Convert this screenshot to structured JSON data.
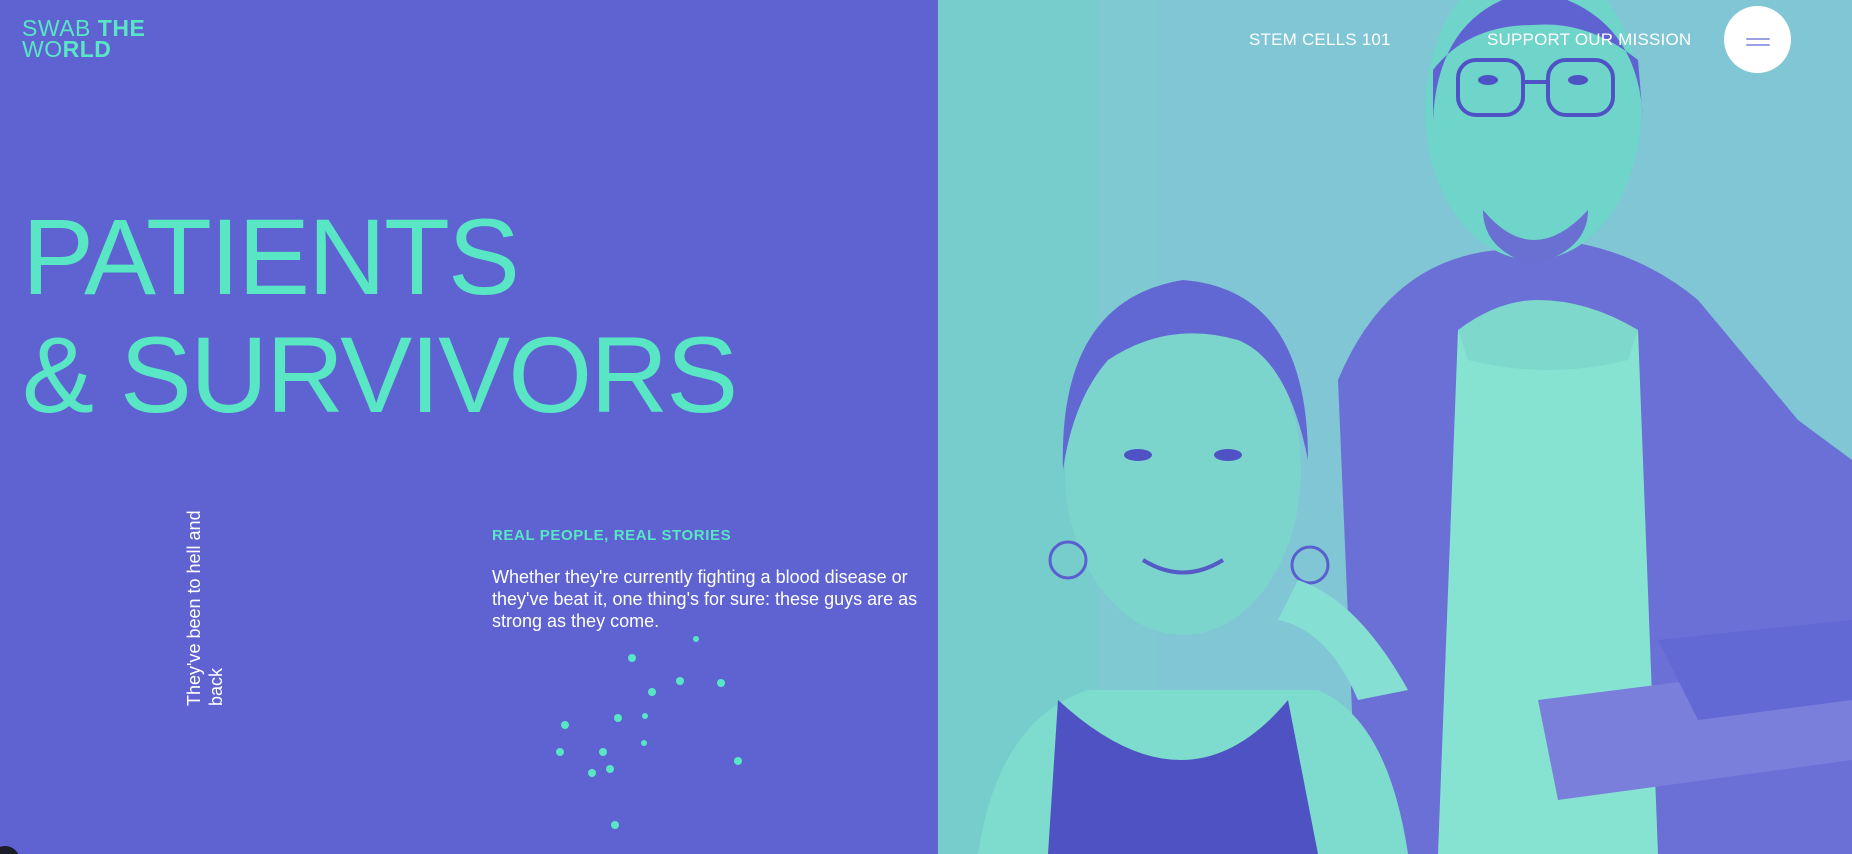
{
  "logo": {
    "line1_thin": "SWAB ",
    "line1_bold": "THE",
    "line2_thin": "WO",
    "line2_bold": "RLD"
  },
  "nav": {
    "stem_cells": "STEM CELLS 101",
    "support": "SUPPORT OUR MISSION",
    "menu_icon": "hamburger-icon"
  },
  "hero": {
    "title_line1": "PATIENTS",
    "title_line2": "& SURVIVORS"
  },
  "side_caption": "They've been to hell and back",
  "section": {
    "eyebrow": "REAL PEOPLE, REAL STORIES",
    "intro": "Whether they're currently fighting a blood disease or they've beat it, one thing's for sure: these guys are as strong as they come."
  },
  "colors": {
    "background": "#5e63d1",
    "accent": "#58e6c4",
    "text": "#ffffff"
  }
}
